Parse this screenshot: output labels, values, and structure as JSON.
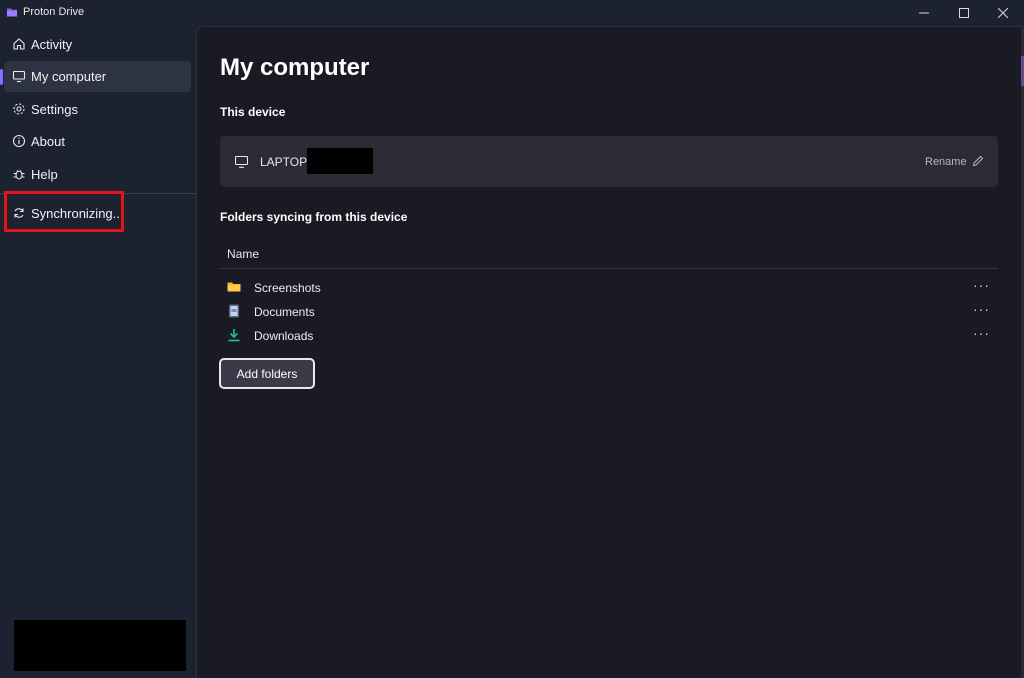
{
  "window": {
    "app_title": "Proton Drive",
    "controls": [
      "minimize",
      "maximize",
      "close"
    ]
  },
  "sidebar": {
    "items": [
      {
        "label": "Activity",
        "icon": "home-icon",
        "active": false
      },
      {
        "label": "My computer",
        "icon": "monitor-icon",
        "active": true
      },
      {
        "label": "Settings",
        "icon": "gear-icon",
        "active": false
      },
      {
        "label": "About",
        "icon": "info-icon",
        "active": false
      },
      {
        "label": "Help",
        "icon": "bug-icon",
        "active": false
      }
    ],
    "status": {
      "label": "Synchronizing...",
      "icon": "sync-icon"
    }
  },
  "main": {
    "title": "My computer",
    "device_section_label": "This device",
    "device": {
      "name": "LAPTOP-",
      "rename_label": "Rename"
    },
    "folders_section_label": "Folders syncing from this device",
    "table": {
      "column_name": "Name",
      "folders": [
        {
          "name": "Screenshots",
          "icon": "folder-icon"
        },
        {
          "name": "Documents",
          "icon": "documents-icon"
        },
        {
          "name": "Downloads",
          "icon": "download-icon"
        }
      ],
      "more_label": "···"
    },
    "add_button_label": "Add folders"
  },
  "colors": {
    "sidebar_bg": "#1c2230",
    "main_bg": "#1a1a24",
    "card_bg": "#2b2b36",
    "accent": "#8a6cff",
    "highlight": "#e3141c"
  }
}
